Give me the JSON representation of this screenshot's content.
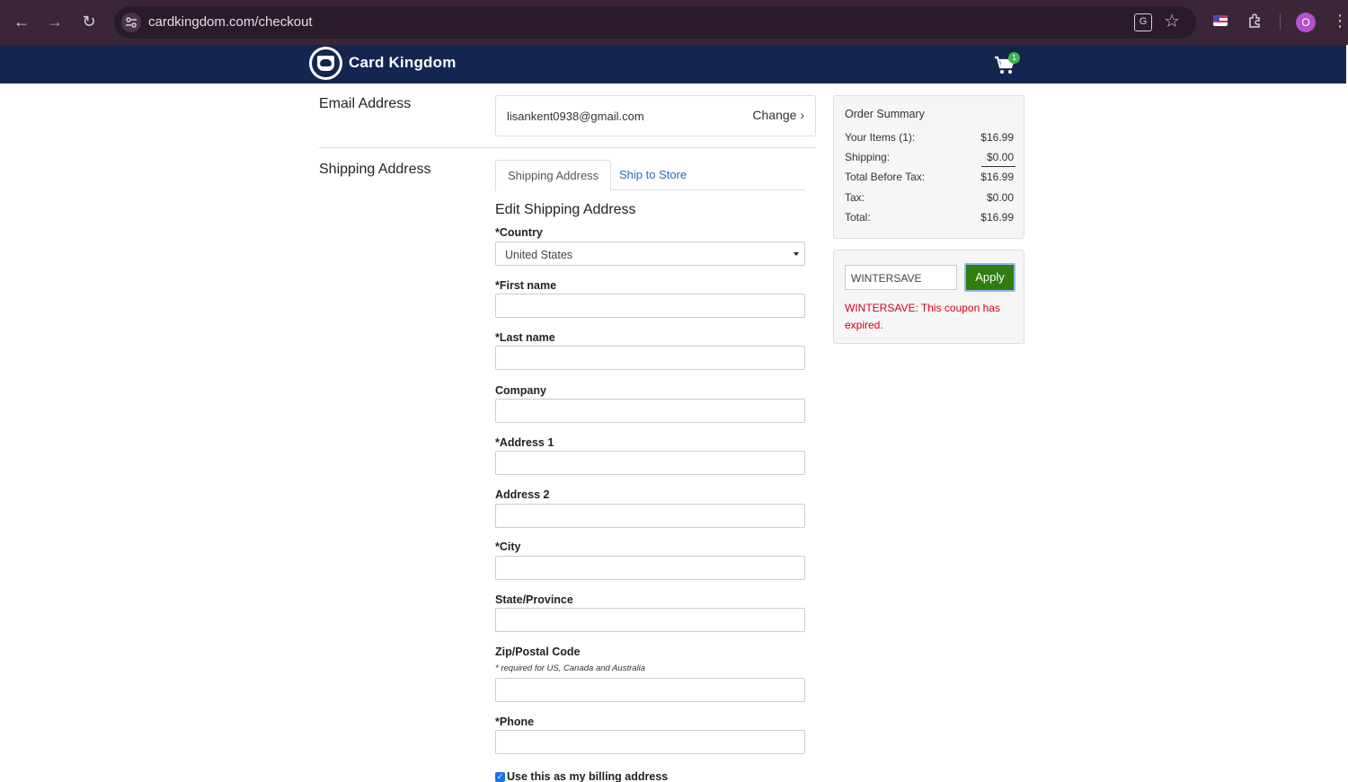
{
  "browser": {
    "url": "cardkingdom.com/checkout",
    "profile_initial": "O"
  },
  "header": {
    "brand": "Card Kingdom",
    "cart_count": "1"
  },
  "email": {
    "label": "Email Address",
    "value": "lisankent0938@gmail.com",
    "change_label": "Change"
  },
  "shipping": {
    "label": "Shipping Address",
    "tabs": [
      {
        "label": "Shipping Address"
      },
      {
        "label": "Ship to Store"
      }
    ],
    "form_title": "Edit Shipping Address",
    "country": {
      "label": "*Country",
      "value": "United States"
    },
    "fields": [
      {
        "label": "*First name"
      },
      {
        "label": "*Last name"
      },
      {
        "label": "Company"
      },
      {
        "label": "*Address 1"
      },
      {
        "label": "Address 2"
      },
      {
        "label": "*City"
      },
      {
        "label": "State/Province"
      },
      {
        "label": "Zip/Postal Code",
        "hint": "* required for US, Canada and Australia"
      },
      {
        "label": "*Phone"
      }
    ],
    "billing_label": "Use this as my billing address"
  },
  "summary": {
    "title": "Order Summary",
    "rows": [
      {
        "label": "Your Items (1):",
        "value": "$16.99"
      },
      {
        "label": "Shipping:",
        "value": "$0.00"
      },
      {
        "label": "Total Before Tax:",
        "value": "$16.99"
      },
      {
        "label": "Tax:",
        "value": "$0.00"
      },
      {
        "label": "Total:",
        "value": "$16.99"
      }
    ]
  },
  "coupon": {
    "value": "WINTERSAVE",
    "apply_label": "Apply",
    "error": "WINTERSAVE: This coupon has expired."
  },
  "colors": {
    "header_bg": "#14254f",
    "apply_bg": "#2e7d0e",
    "error": "#d0021b",
    "link": "#2b6cb0"
  }
}
